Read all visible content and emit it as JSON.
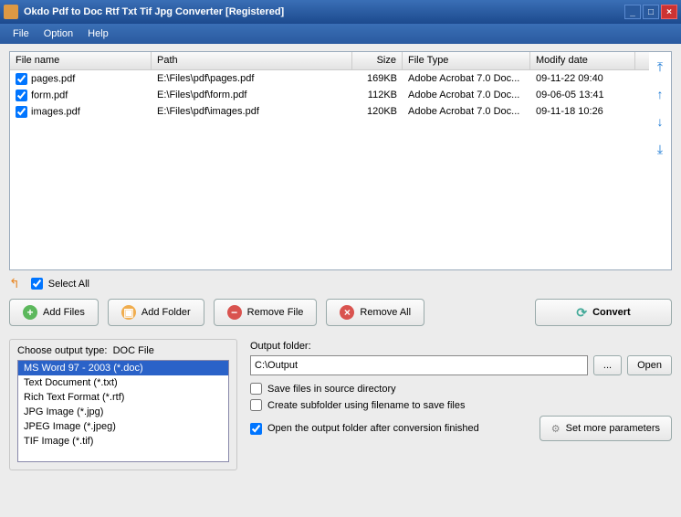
{
  "window": {
    "title": "Okdo Pdf to Doc Rtf Txt Tif Jpg Converter [Registered]"
  },
  "menu": {
    "file": "File",
    "option": "Option",
    "help": "Help"
  },
  "columns": {
    "name": "File name",
    "path": "Path",
    "size": "Size",
    "type": "File Type",
    "date": "Modify date"
  },
  "files": [
    {
      "name": "pages.pdf",
      "path": "E:\\Files\\pdf\\pages.pdf",
      "size": "169KB",
      "type": "Adobe Acrobat 7.0 Doc...",
      "date": "09-11-22 09:40"
    },
    {
      "name": "form.pdf",
      "path": "E:\\Files\\pdf\\form.pdf",
      "size": "112KB",
      "type": "Adobe Acrobat 7.0 Doc...",
      "date": "09-06-05 13:41"
    },
    {
      "name": "images.pdf",
      "path": "E:\\Files\\pdf\\images.pdf",
      "size": "120KB",
      "type": "Adobe Acrobat 7.0 Doc...",
      "date": "09-11-18 10:26"
    }
  ],
  "selectall": "Select All",
  "buttons": {
    "addfiles": "Add Files",
    "addfolder": "Add Folder",
    "removefile": "Remove File",
    "removeall": "Remove All",
    "convert": "Convert"
  },
  "outtype": {
    "label_prefix": "Choose output type:",
    "current": "DOC File",
    "items": [
      "MS Word 97 - 2003 (*.doc)",
      "Text Document (*.txt)",
      "Rich Text Format (*.rtf)",
      "JPG Image (*.jpg)",
      "JPEG Image (*.jpeg)",
      "TIF Image (*.tif)"
    ]
  },
  "outfolder": {
    "label": "Output folder:",
    "value": "C:\\Output",
    "browse": "...",
    "open": "Open",
    "save_in_source": "Save files in source directory",
    "create_subfolder": "Create subfolder using filename to save files",
    "open_after": "Open the output folder after conversion finished",
    "more_params": "Set more parameters"
  }
}
